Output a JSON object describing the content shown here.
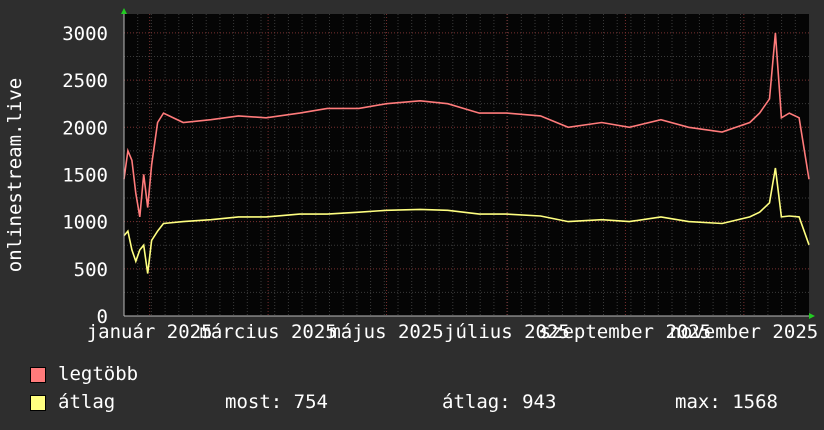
{
  "chart_data": {
    "type": "line",
    "ylabel": "onlinestream.live",
    "ylim": [
      0,
      3200
    ],
    "yticks": [
      0,
      500,
      1000,
      1500,
      2000,
      2500,
      3000
    ],
    "xlim": [
      "2025-01-02",
      "2025-12-15"
    ],
    "xtick_labels": [
      {
        "date": "2025-01-15",
        "label": "január 2025"
      },
      {
        "date": "2025-03-16",
        "label": "március 2025"
      },
      {
        "date": "2025-05-15",
        "label": "május 2025"
      },
      {
        "date": "2025-07-15",
        "label": "július 2025"
      },
      {
        "date": "2025-09-13",
        "label": "szeptember 2025"
      },
      {
        "date": "2025-11-12",
        "label": "november 2025"
      }
    ],
    "grid": true,
    "series": [
      {
        "name": "legtöbb",
        "color": "#ff7b7b",
        "x": [
          "2025-01-02",
          "2025-01-04",
          "2025-01-06",
          "2025-01-08",
          "2025-01-10",
          "2025-01-12",
          "2025-01-14",
          "2025-01-16",
          "2025-01-19",
          "2025-01-22",
          "2025-02-01",
          "2025-02-15",
          "2025-03-01",
          "2025-03-15",
          "2025-04-01",
          "2025-04-15",
          "2025-05-01",
          "2025-05-15",
          "2025-06-01",
          "2025-06-15",
          "2025-07-01",
          "2025-07-15",
          "2025-08-01",
          "2025-08-15",
          "2025-09-01",
          "2025-09-15",
          "2025-10-01",
          "2025-10-15",
          "2025-11-01",
          "2025-11-15",
          "2025-11-20",
          "2025-11-25",
          "2025-11-28",
          "2025-12-01",
          "2025-12-05",
          "2025-12-10",
          "2025-12-15"
        ],
        "values": [
          1450,
          1750,
          1650,
          1300,
          1050,
          1500,
          1150,
          1600,
          2050,
          2150,
          2050,
          2080,
          2120,
          2100,
          2150,
          2200,
          2200,
          2250,
          2280,
          2250,
          2150,
          2150,
          2120,
          2000,
          2050,
          2000,
          2080,
          2000,
          1950,
          2050,
          2150,
          2300,
          3000,
          2100,
          2150,
          2100,
          1450
        ]
      },
      {
        "name": "átlag",
        "color": "#ffff80",
        "x": [
          "2025-01-02",
          "2025-01-04",
          "2025-01-06",
          "2025-01-08",
          "2025-01-10",
          "2025-01-12",
          "2025-01-14",
          "2025-01-16",
          "2025-01-19",
          "2025-01-22",
          "2025-02-01",
          "2025-02-15",
          "2025-03-01",
          "2025-03-15",
          "2025-04-01",
          "2025-04-15",
          "2025-05-01",
          "2025-05-15",
          "2025-06-01",
          "2025-06-15",
          "2025-07-01",
          "2025-07-15",
          "2025-08-01",
          "2025-08-15",
          "2025-09-01",
          "2025-09-15",
          "2025-10-01",
          "2025-10-15",
          "2025-11-01",
          "2025-11-15",
          "2025-11-20",
          "2025-11-25",
          "2025-11-28",
          "2025-12-01",
          "2025-12-05",
          "2025-12-10",
          "2025-12-15"
        ],
        "values": [
          850,
          900,
          700,
          580,
          700,
          750,
          450,
          800,
          900,
          980,
          1000,
          1020,
          1050,
          1050,
          1080,
          1080,
          1100,
          1120,
          1130,
          1120,
          1080,
          1080,
          1060,
          1000,
          1020,
          1000,
          1050,
          1000,
          980,
          1050,
          1100,
          1200,
          1568,
          1050,
          1060,
          1050,
          754
        ]
      }
    ],
    "stats": {
      "now_label": "most:",
      "now": "754",
      "avg_label": "átlag:",
      "avg": "943",
      "max_label": "max:",
      "max": "1568"
    }
  }
}
